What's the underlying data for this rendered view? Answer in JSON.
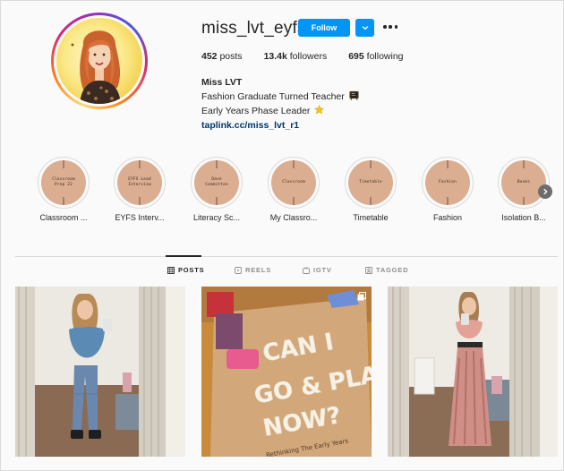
{
  "profile": {
    "username": "miss_lvt_eyfs",
    "follow_label": "Follow",
    "stats": [
      {
        "count": "452",
        "label": "posts"
      },
      {
        "count": "13.4k",
        "label": "followers"
      },
      {
        "count": "695",
        "label": "following"
      }
    ],
    "name": "Miss LVT",
    "bio_line1": "Fashion Graduate Turned Teacher",
    "bio_line2": "Early Years Phase Leader",
    "link": "taplink.cc/miss_lvt_r1",
    "bio_emojis": [
      "chalkboard-emoji",
      "star-emoji"
    ]
  },
  "highlights": [
    {
      "cover_text": "Classroom Prep 22",
      "label": "Classroom ..."
    },
    {
      "cover_text": "EYFS Lead Interview",
      "label": "EYFS Interv..."
    },
    {
      "cover_text": "Dave Committee",
      "label": "Literacy Sc..."
    },
    {
      "cover_text": "Classroom",
      "label": "My Classro..."
    },
    {
      "cover_text": "Timetable",
      "label": "Timetable"
    },
    {
      "cover_text": "Fashion",
      "label": "Fashion"
    },
    {
      "cover_text": "Books",
      "label": "Isolation B..."
    }
  ],
  "tabs": [
    {
      "label": "POSTS",
      "icon": "grid-icon",
      "active": true
    },
    {
      "label": "REELS",
      "icon": "reels-icon",
      "active": false
    },
    {
      "label": "IGTV",
      "icon": "igtv-icon",
      "active": false
    },
    {
      "label": "TAGGED",
      "icon": "tagged-icon",
      "active": false
    }
  ],
  "posts": [
    {
      "type": "photo",
      "description_icon": "mirror-selfie"
    },
    {
      "type": "photo",
      "book_title": [
        "CAN I",
        "GO & PLAY",
        "NOW?"
      ],
      "book_subtitle": "Rethinking The Early Years"
    },
    {
      "type": "photo",
      "description_icon": "mirror-selfie"
    }
  ],
  "colors": {
    "follow_blue": "#0095f6",
    "link_blue": "#00376b",
    "highlight_fill": "#dcae91",
    "text_dark": "#262626",
    "text_muted": "#8e8e8e"
  }
}
